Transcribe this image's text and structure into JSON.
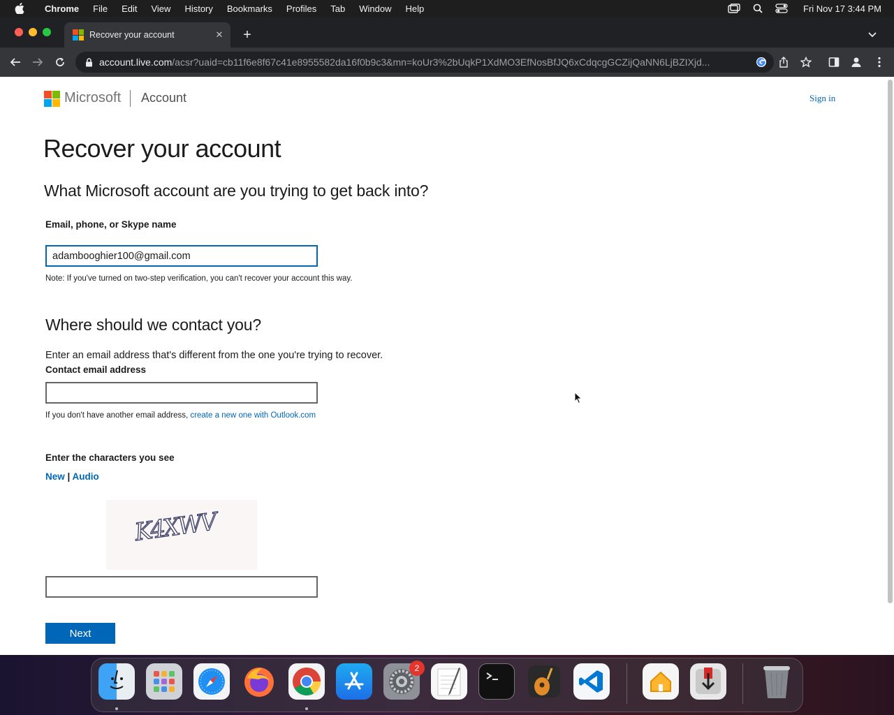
{
  "menubar": {
    "app_name": "Chrome",
    "items": [
      "File",
      "Edit",
      "View",
      "History",
      "Bookmarks",
      "Profiles",
      "Tab",
      "Window",
      "Help"
    ],
    "clock": "Fri Nov 17  3:44 PM"
  },
  "browser": {
    "tab_title": "Recover your account",
    "tab_close": "✕",
    "new_tab": "+",
    "url_host": "account.live.com",
    "url_path": "/acsr?uaid=cb11f6e8f67c41e8955582da16f0b9c3&mn=koUr3%2bUqkP1XdMO3EfNosBfJQ6xCdqcgGCZijQaNN6LjBZIXjd..."
  },
  "header": {
    "brand": "Microsoft",
    "section": "Account",
    "sign_in": "Sign in"
  },
  "form": {
    "title": "Recover your account",
    "subtitle": "What Microsoft account are you trying to get back into?",
    "account_label": "Email, phone, or Skype name",
    "account_value": "adambooghier100@gmail.com",
    "account_note": "Note: If you've turned on two-step verification, you can't recover your account this way.",
    "contact_heading": "Where should we contact you?",
    "contact_instruction": "Enter an email address that's different from the one you're trying to recover.",
    "contact_label": "Contact email address",
    "contact_value": "",
    "contact_note_prefix": "If you don't have another email address, ",
    "contact_note_link": "create a new one with Outlook.com",
    "captcha_label": "Enter the characters you see",
    "captcha_new": "New",
    "captcha_separator": " | ",
    "captcha_audio": "Audio",
    "captcha_text": "K4XWV",
    "captcha_value": "",
    "next_button": "Next"
  },
  "colors": {
    "accent": "#0067b8",
    "ms_red": "#f25022",
    "ms_green": "#7fba00",
    "ms_blue": "#00a4ef",
    "ms_yellow": "#ffb900"
  },
  "dock": {
    "apps": [
      "finder-icon",
      "launchpad-icon",
      "safari-icon",
      "firefox-icon",
      "chrome-icon",
      "app-store-icon",
      "system-settings-icon",
      "textedit-icon",
      "terminal-icon",
      "garageband-icon",
      "vscode-icon",
      "home-icon",
      "downloader-icon",
      "trash-icon"
    ],
    "settings_badge": "2"
  }
}
